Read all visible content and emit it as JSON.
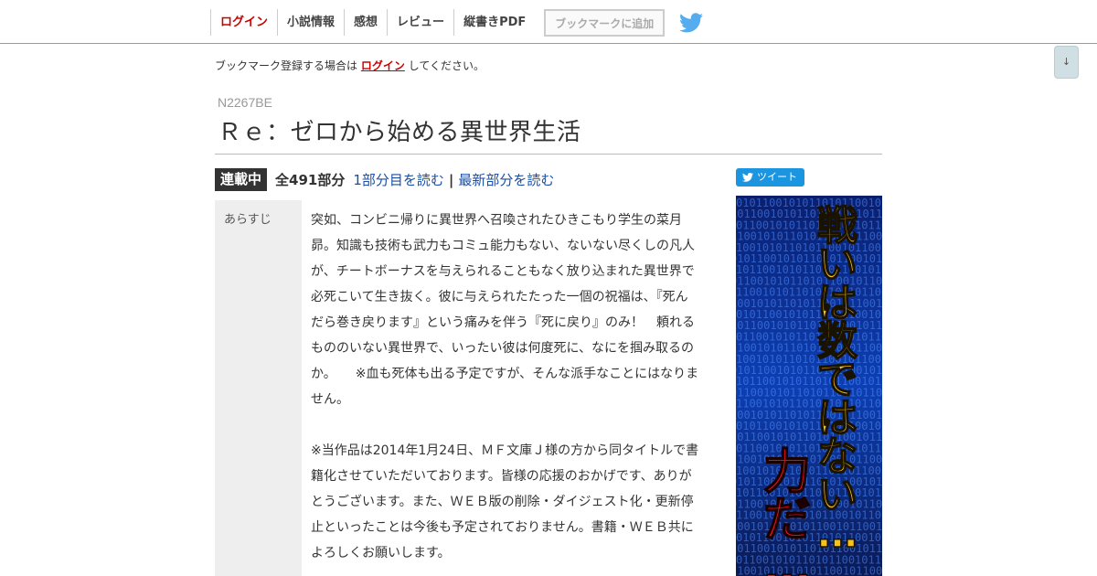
{
  "nav": {
    "items": [
      "ログイン",
      "小説情報",
      "感想",
      "レビュー",
      "縦書きPDF"
    ],
    "bookmark_label": "ブックマークに追加",
    "twitter_icon": "twitter-bird-icon"
  },
  "scroll_button": {
    "label": "↓"
  },
  "notice": {
    "before": "ブックマーク登録する場合は",
    "link": "ログイン",
    "after": "してください。"
  },
  "novel": {
    "ncode": "N2267BE",
    "title": "Ｒｅ：ゼロから始める異世界生活",
    "status": "連載中",
    "episode_count": "全491部分",
    "read_first": "1部分目を読む",
    "separator": "|",
    "read_latest": "最新部分を読む"
  },
  "synopsis": {
    "label": "あらすじ",
    "p1": "突如、コンビニ帰りに異世界へ召喚されたひきこもり学生の菜月昴。知識も技術も武力もコミュ能力もない、ないない尽くしの凡人が、チートボーナスを与えられることもなく放り込まれた異世界で必死こいて生き抜く。彼に与えられたたった一個の祝福は、『死んだら巻き戻ります』という痛みを伴う『死に戻り』のみ！　頼れるもののいない異世界で、いったい彼は何度死に、なにを掴み取るのか。　　※血も死体も出る予定ですが、そんな派手なことにはなりません。",
    "p2": "※当作品は2014年1月24日、ＭＦ文庫Ｊ様の方から同タイトルで書籍化させていただいております。皆様の応援のおかげです、ありがとうございます。また、ＷＥＢ版の削除・ダイジェスト化・更新停止といったことは今後も予定されておりません。書籍・ＷＥＢ共によろしくお願いします。"
  },
  "tweet": {
    "label": "ツイート"
  },
  "banner": {
    "line_yellow": [
      "戦",
      "い",
      "は",
      "数",
      "で",
      "は",
      "な",
      "い",
      "…"
    ],
    "line_red": [
      "力",
      "だ",
      "…"
    ],
    "colors": {
      "yellow": "#f7c21a",
      "red": "#e8141e",
      "bg": "#0a2a8a"
    }
  }
}
